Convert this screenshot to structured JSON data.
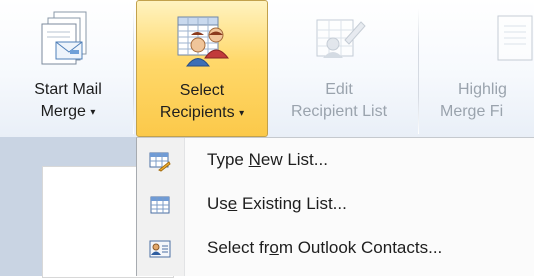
{
  "ribbon": {
    "buttons": [
      {
        "line1": "Start Mail",
        "line2": "Merge",
        "caret": "▾",
        "state": "normal",
        "icon": "start-mail-merge-icon"
      },
      {
        "line1": "Select",
        "line2": "Recipients",
        "caret": "▾",
        "state": "selected",
        "icon": "select-recipients-icon"
      },
      {
        "line1": "Edit",
        "line2": "Recipient List",
        "state": "disabled",
        "icon": "edit-recipient-list-icon"
      },
      {
        "line1": "Highlig",
        "line2": "Merge Fi",
        "state": "disabled",
        "icon": "highlight-merge-fields-icon"
      }
    ]
  },
  "menu": {
    "items": [
      {
        "pre": "Type ",
        "mnemonic": "N",
        "post": "ew List...",
        "icon": "type-new-list-icon"
      },
      {
        "pre": "Us",
        "mnemonic": "e",
        "post": " Existing List...",
        "icon": "use-existing-list-icon"
      },
      {
        "pre": "Select fr",
        "mnemonic": "o",
        "post": "m Outlook Contacts...",
        "icon": "outlook-contacts-icon"
      }
    ]
  },
  "colors": {
    "selected_fill": "#ffd86a",
    "disabled_text": "#9aa3ad",
    "workspace": "#c9d4e3"
  }
}
